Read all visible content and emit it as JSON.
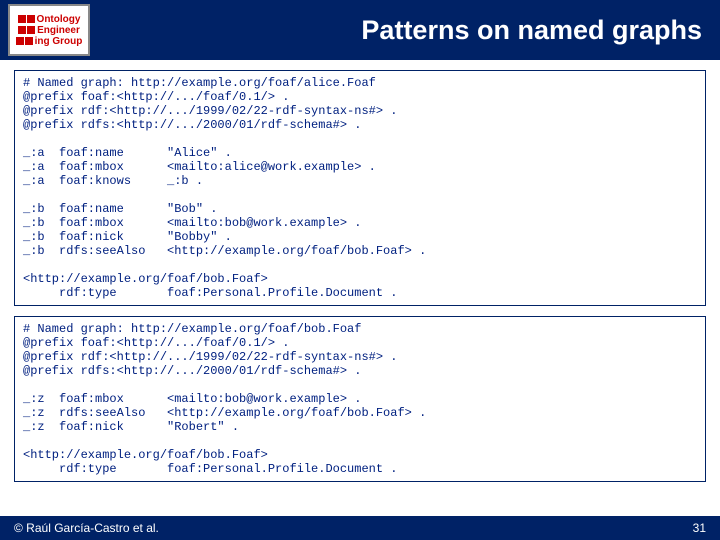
{
  "logo": {
    "l1": "Ontology",
    "l2": "Engineer",
    "l3": "ing Group"
  },
  "title": "Patterns on named graphs",
  "code1": "# Named graph: http://example.org/foaf/alice.Foaf\n@prefix foaf:<http://.../foaf/0.1/> .\n@prefix rdf:<http://.../1999/02/22-rdf-syntax-ns#> .\n@prefix rdfs:<http://.../2000/01/rdf-schema#> .\n\n_:a  foaf:name      \"Alice\" .\n_:a  foaf:mbox      <mailto:alice@work.example> .\n_:a  foaf:knows     _:b .\n\n_:b  foaf:name      \"Bob\" .\n_:b  foaf:mbox      <mailto:bob@work.example> .\n_:b  foaf:nick      \"Bobby\" .\n_:b  rdfs:seeAlso   <http://example.org/foaf/bob.Foaf> .\n\n<http://example.org/foaf/bob.Foaf>\n     rdf:type       foaf:Personal.Profile.Document .",
  "code2": "# Named graph: http://example.org/foaf/bob.Foaf\n@prefix foaf:<http://.../foaf/0.1/> .\n@prefix rdf:<http://.../1999/02/22-rdf-syntax-ns#> .\n@prefix rdfs:<http://.../2000/01/rdf-schema#> .\n\n_:z  foaf:mbox      <mailto:bob@work.example> .\n_:z  rdfs:seeAlso   <http://example.org/foaf/bob.Foaf> .\n_:z  foaf:nick      \"Robert\" .\n\n<http://example.org/foaf/bob.Foaf>\n     rdf:type       foaf:Personal.Profile.Document .",
  "footer_left": "© Raúl García-Castro et al.",
  "footer_right": "31"
}
